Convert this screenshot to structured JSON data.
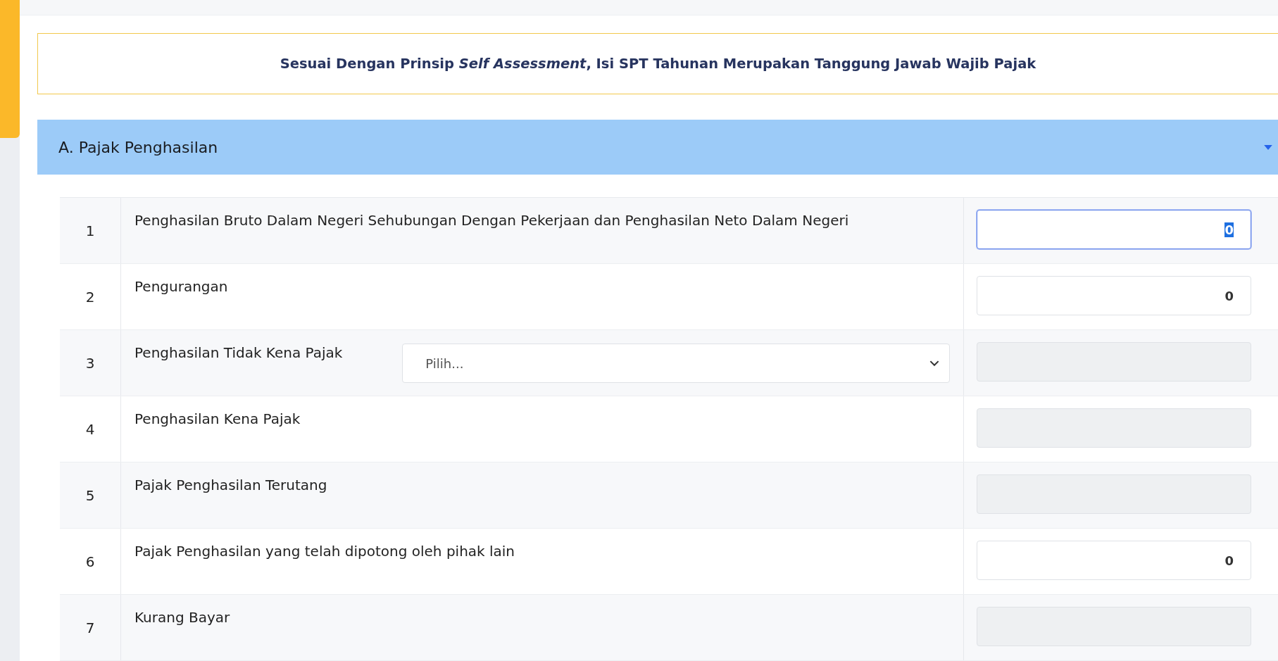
{
  "notice": "Sesuai Dengan Prinsip *Self Assessment*, Isi SPT Tahunan Merupakan Tanggung Jawab Wajib Pajak",
  "section": {
    "title": "A. Pajak Penghasilan",
    "expanded": true,
    "rows": [
      {
        "number": "1",
        "label": "Penghasilan Bruto Dalam Negeri Sehubungan Dengan Pekerjaan dan Penghasilan Neto Dalam Negeri",
        "field": {
          "value": "0",
          "disabled": false,
          "focused": true
        }
      },
      {
        "number": "2",
        "label": "Pengurangan",
        "field": {
          "value": "0",
          "disabled": false,
          "focused": false
        }
      },
      {
        "number": "3",
        "label": "Penghasilan Tidak Kena Pajak",
        "select": {
          "placeholder": "Pilih..."
        },
        "field": {
          "disabled": true,
          "focused": false
        }
      },
      {
        "number": "4",
        "label": "Penghasilan Kena Pajak",
        "field": {
          "disabled": true,
          "focused": false
        }
      },
      {
        "number": "5",
        "label": "Pajak Penghasilan Terutang",
        "field": {
          "disabled": true,
          "focused": false
        }
      },
      {
        "number": "6",
        "label": "Pajak Penghasilan yang telah dipotong oleh pihak lain",
        "field": {
          "value": "0",
          "disabled": false,
          "focused": false
        }
      },
      {
        "number": "7",
        "label": "Kurang Bayar",
        "field": {
          "disabled": true,
          "focused": false
        }
      }
    ]
  }
}
